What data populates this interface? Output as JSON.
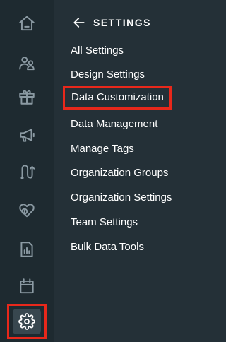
{
  "sidebar": {
    "icons": [
      {
        "name": "home-icon"
      },
      {
        "name": "people-icon"
      },
      {
        "name": "gift-icon"
      },
      {
        "name": "megaphone-icon"
      },
      {
        "name": "journey-icon"
      },
      {
        "name": "donation-heart-icon"
      },
      {
        "name": "report-icon"
      },
      {
        "name": "calendar-icon"
      },
      {
        "name": "gear-icon",
        "active": true
      }
    ]
  },
  "panel": {
    "title": "SETTINGS",
    "back_icon": "arrow-left-icon",
    "items": [
      {
        "label": "All Settings"
      },
      {
        "label": "Design Settings"
      },
      {
        "label": "Data Customization",
        "highlighted": true
      },
      {
        "label": "Data Management"
      },
      {
        "label": "Manage Tags"
      },
      {
        "label": "Organization Groups"
      },
      {
        "label": "Organization Settings"
      },
      {
        "label": "Team Settings"
      },
      {
        "label": "Bulk Data Tools"
      }
    ]
  },
  "colors": {
    "rail_bg": "#1e2a30",
    "panel_bg": "#243037",
    "icon_color": "#8b9aa3",
    "highlight_border": "#e8281b",
    "text": "#ffffff"
  }
}
